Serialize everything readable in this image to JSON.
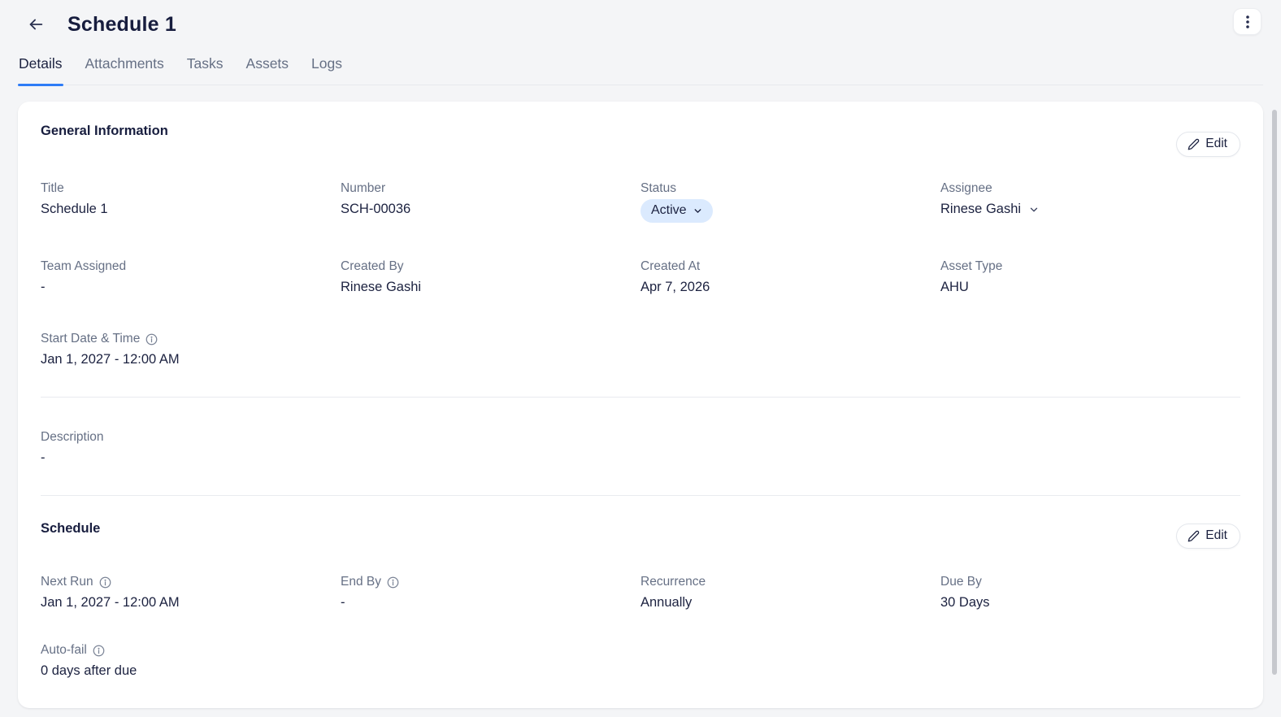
{
  "header": {
    "title": "Schedule 1"
  },
  "tabs": {
    "items": [
      {
        "label": "Details",
        "active": true
      },
      {
        "label": "Attachments",
        "active": false
      },
      {
        "label": "Tasks",
        "active": false
      },
      {
        "label": "Assets",
        "active": false
      },
      {
        "label": "Logs",
        "active": false
      }
    ]
  },
  "sections": {
    "general": {
      "heading": "General Information",
      "edit_label": "Edit",
      "title": {
        "label": "Title",
        "value": "Schedule 1"
      },
      "number": {
        "label": "Number",
        "value": "SCH-00036"
      },
      "status": {
        "label": "Status",
        "value": "Active"
      },
      "assignee": {
        "label": "Assignee",
        "value": "Rinese Gashi"
      },
      "team_assigned": {
        "label": "Team Assigned",
        "value": "-"
      },
      "created_by": {
        "label": "Created By",
        "value": "Rinese Gashi"
      },
      "created_at": {
        "label": "Created At",
        "value": "Apr 7, 2026"
      },
      "asset_type": {
        "label": "Asset Type",
        "value": "AHU"
      },
      "start_date_time": {
        "label": "Start Date & Time",
        "value": "Jan 1, 2027 - 12:00 AM"
      },
      "description": {
        "label": "Description",
        "value": "-"
      }
    },
    "schedule": {
      "heading": "Schedule",
      "edit_label": "Edit",
      "next_run": {
        "label": "Next Run",
        "value": "Jan 1, 2027 - 12:00 AM"
      },
      "end_by": {
        "label": "End By",
        "value": "-"
      },
      "recurrence": {
        "label": "Recurrence",
        "value": "Annually"
      },
      "due_by": {
        "label": "Due By",
        "value": "30 Days"
      },
      "auto_fail": {
        "label": "Auto-fail",
        "value": "0 days after due"
      }
    }
  },
  "icons": {
    "back": "arrow-left",
    "kebab": "three-dots-vertical",
    "edit": "pencil",
    "chevron": "chevron-down",
    "info": "info-circle"
  },
  "colors": {
    "accent_blue": "#2e7cf6",
    "status_pill_bg": "#dbeafe",
    "text_dark": "#1c2240",
    "text_muted": "#667085",
    "page_bg": "#f4f5f7",
    "card_bg": "#ffffff"
  }
}
